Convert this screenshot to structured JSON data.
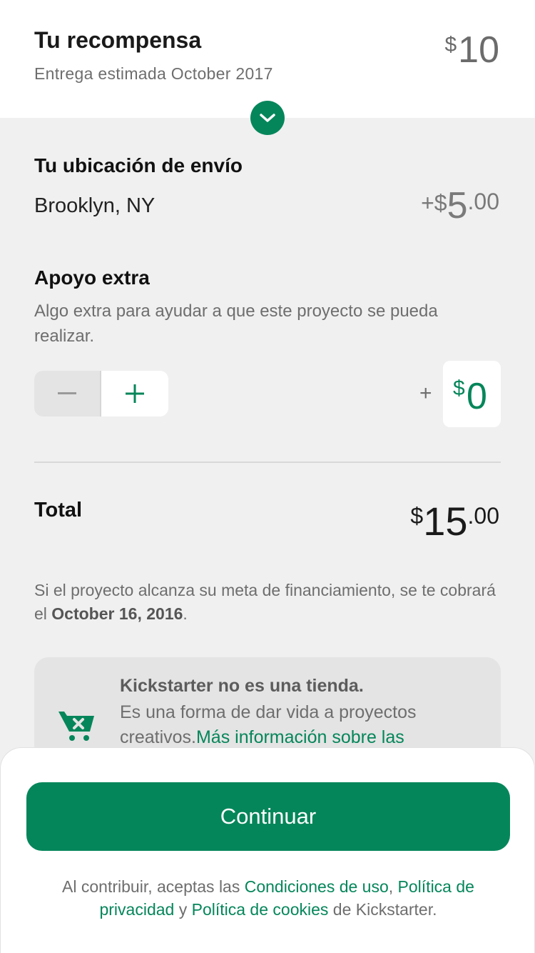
{
  "reward": {
    "title": "Tu recompensa",
    "delivery": "Entrega estimada October 2017",
    "currency": "$",
    "amount": "10"
  },
  "expand_icon": "chevron-down-icon",
  "shipping": {
    "title": "Tu ubicación de envío",
    "location": "Brooklyn, NY",
    "prefix": "+$",
    "amount": "5",
    "decimals": ".00"
  },
  "extra": {
    "title": "Apoyo extra",
    "description": "Algo extra para ayudar a que este proyecto se pueda realizar.",
    "plus_sign": "+",
    "currency": "$",
    "amount": "0",
    "minus_icon": "minus-icon",
    "plus_icon": "plus-icon"
  },
  "total": {
    "label": "Total",
    "currency": "$",
    "amount": "15",
    "decimals": ".00"
  },
  "charge_note": {
    "text": "Si el proyecto alcanza su meta de financiamiento, se te cobrará el ",
    "date": "October 16, 2016",
    "end": "."
  },
  "info_card": {
    "icon": "cart-x-icon",
    "title": "Kickstarter no es una tienda.",
    "body": "Es una forma de dar vida a proyectos creativos.",
    "link": "Más información sobre las"
  },
  "continue_label": "Continuar",
  "terms": {
    "prefix": "Al contribuir, aceptas las ",
    "terms_link": "Condiciones de uso",
    "comma": ",",
    "privacy_link": "Política de privacidad",
    "and": " y ",
    "cookies_link": "Política de cookies",
    "suffix": " de Kickstarter."
  },
  "colors": {
    "accent": "#05865a",
    "background": "#f0f0f0",
    "muted_text": "#6e6e6e"
  }
}
